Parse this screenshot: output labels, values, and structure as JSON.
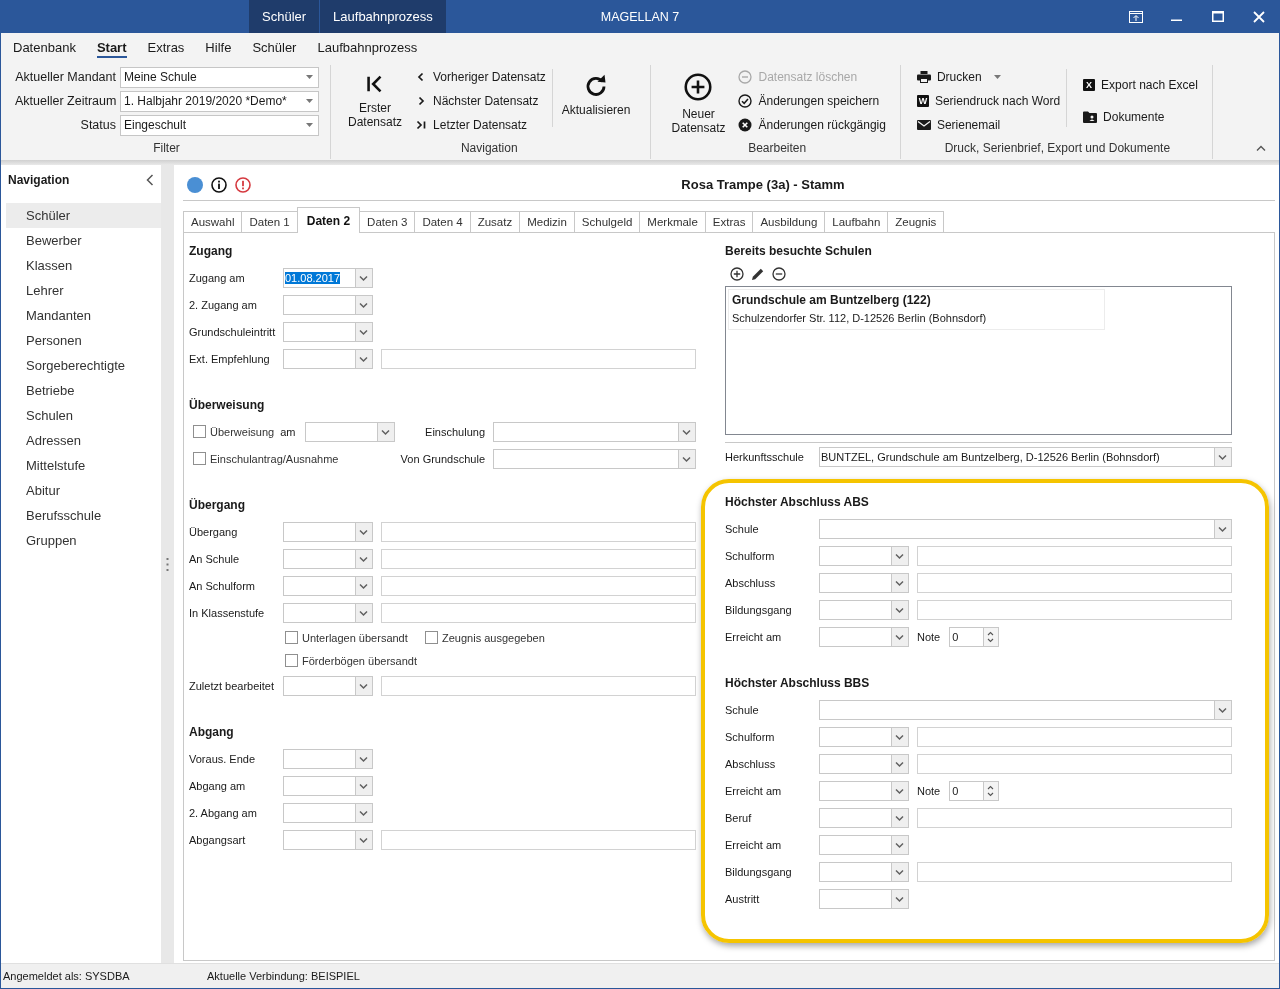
{
  "window": {
    "title": "MAGELLAN 7",
    "context_tabs": [
      "Schüler",
      "Laufbahnprozess"
    ]
  },
  "menu": [
    {
      "label": "Datenbank",
      "selected": false
    },
    {
      "label": "Start",
      "selected": true
    },
    {
      "label": "Extras",
      "selected": false
    },
    {
      "label": "Hilfe",
      "selected": false
    },
    {
      "label": "Schüler",
      "selected": false
    },
    {
      "label": "Laufbahnprozess",
      "selected": false
    }
  ],
  "ribbon": {
    "filter": {
      "label": "Filter",
      "fields": [
        {
          "label": "Aktueller Mandant",
          "value": "Meine Schule"
        },
        {
          "label": "Aktueller Zeitraum",
          "value": "1. Halbjahr 2019/2020 *Demo*"
        },
        {
          "label": "Status",
          "value": "Eingeschult"
        }
      ]
    },
    "groups": [
      {
        "label": "Navigation",
        "columns": [
          {
            "kind": "large",
            "items": [
              {
                "label": "Erster Datensatz"
              }
            ]
          },
          {
            "kind": "small",
            "items": [
              {
                "label": "Vorheriger Datensatz"
              },
              {
                "label": "Nächster Datensatz"
              },
              {
                "label": "Letzter Datensatz"
              }
            ]
          },
          {
            "kind": "large",
            "items": [
              {
                "label": "Aktualisieren"
              }
            ]
          }
        ]
      },
      {
        "label": "Bearbeiten",
        "columns": [
          {
            "kind": "large",
            "items": [
              {
                "label": "Neuer Datensatz"
              }
            ]
          },
          {
            "kind": "small",
            "items": [
              {
                "label": "Datensatz löschen",
                "disabled": true
              },
              {
                "label": "Änderungen speichern",
                "disabled": false
              },
              {
                "label": "Änderungen rückgängig",
                "disabled": false
              }
            ]
          }
        ]
      },
      {
        "label": "Druck, Serienbrief, Export und Dokumente",
        "columns": [
          {
            "kind": "small",
            "items": [
              {
                "label": "Drucken",
                "dropdown": true
              },
              {
                "label": "Seriendruck nach Word",
                "dropdown": false,
                "tile_letter": "W"
              },
              {
                "label": "Serienemail",
                "dropdown": false
              }
            ]
          },
          {
            "kind": "small",
            "items": [
              {
                "label": "Export nach Excel",
                "tile_letter": "X"
              },
              {
                "label": "Dokumente"
              }
            ]
          }
        ]
      }
    ]
  },
  "navigation": {
    "title": "Navigation",
    "items": [
      {
        "label": "Schüler",
        "selected": true
      },
      {
        "label": "Bewerber",
        "selected": false
      },
      {
        "label": "Klassen",
        "selected": false
      },
      {
        "label": "Lehrer",
        "selected": false
      },
      {
        "label": "Mandanten",
        "selected": false
      },
      {
        "label": "Personen",
        "selected": false
      },
      {
        "label": "Sorgeberechtigte",
        "selected": false
      },
      {
        "label": "Betriebe",
        "selected": false
      },
      {
        "label": "Schulen",
        "selected": false
      },
      {
        "label": "Adressen",
        "selected": false
      },
      {
        "label": "Mittelstufe",
        "selected": false
      },
      {
        "label": "Abitur",
        "selected": false
      },
      {
        "label": "Berufsschule",
        "selected": false
      },
      {
        "label": "Gruppen",
        "selected": false
      }
    ]
  },
  "record": {
    "title": "Rosa Trampe (3a) - Stamm",
    "tabs": [
      {
        "label": "Auswahl",
        "selected": false
      },
      {
        "label": "Daten 1",
        "selected": false
      },
      {
        "label": "Daten 2",
        "selected": true
      },
      {
        "label": "Daten 3",
        "selected": false
      },
      {
        "label": "Daten 4",
        "selected": false
      },
      {
        "label": "Zusatz",
        "selected": false
      },
      {
        "label": "Medizin",
        "selected": false
      },
      {
        "label": "Schulgeld",
        "selected": false
      },
      {
        "label": "Merkmale",
        "selected": false
      },
      {
        "label": "Extras",
        "selected": false
      },
      {
        "label": "Ausbildung",
        "selected": false
      },
      {
        "label": "Laufbahn",
        "selected": false
      },
      {
        "label": "Zeugnis",
        "selected": false
      }
    ],
    "left_sections": [
      {
        "heading": "Zugang",
        "rows": [
          {
            "kind": "combo",
            "label": "Zugang am",
            "value": "01.08.2017",
            "highlighted": true
          },
          {
            "kind": "combo",
            "label": "2. Zugang am"
          },
          {
            "kind": "combo",
            "label": "Grundschuleintritt"
          },
          {
            "kind": "combo_text",
            "label": "Ext. Empfehlung"
          }
        ]
      },
      {
        "heading": "Überweisung",
        "rows": [
          {
            "kind": "check_combo",
            "check": {
              "label": "Überweisung",
              "checked": false
            },
            "label": "am",
            "side_label": "Einschulung"
          },
          {
            "kind": "check_combo",
            "check": {
              "label": "Einschulantrag/Ausnahme",
              "checked": false
            },
            "side_label": "Von Grundschule"
          }
        ]
      },
      {
        "heading": "Übergang",
        "rows": [
          {
            "kind": "combo_text",
            "label": "Übergang"
          },
          {
            "kind": "combo_text",
            "label": "An Schule"
          },
          {
            "kind": "combo_text",
            "label": "An Schulform"
          },
          {
            "kind": "combo_text",
            "label": "In Klassenstufe"
          },
          {
            "kind": "checks",
            "checks": [
              {
                "label": "Unterlagen übersandt",
                "checked": false
              },
              {
                "label": "Zeugnis ausgegeben",
                "checked": false
              }
            ]
          },
          {
            "kind": "checks",
            "checks": [
              {
                "label": "Förderbögen übersandt",
                "checked": false
              }
            ]
          },
          {
            "kind": "combo_text",
            "label": "Zuletzt bearbeitet"
          }
        ]
      },
      {
        "heading": "Abgang",
        "rows": [
          {
            "kind": "combo",
            "label": "Voraus. Ende"
          },
          {
            "kind": "combo",
            "label": "Abgang am"
          },
          {
            "kind": "combo",
            "label": "2. Abgang am"
          },
          {
            "kind": "combo_text",
            "label": "Abgangsart"
          }
        ]
      }
    ],
    "schools": {
      "heading": "Bereits besuchte Schulen",
      "items": [
        {
          "name": "Grundschule am Buntzelberg (122)",
          "address": "Schulzendorfer Str. 112, D-12526 Berlin (Bohnsdorf)"
        }
      ],
      "origin": {
        "label": "Herkunftsschule",
        "value": "BUNTZEL, Grundschule am Buntzelberg, D-12526 Berlin (Bohnsdorf)"
      }
    },
    "highlighted_sections": [
      {
        "heading": "Höchster Abschluss ABS",
        "rows": [
          {
            "kind": "wide_combo",
            "label": "Schule"
          },
          {
            "kind": "combo_text",
            "label": "Schulform"
          },
          {
            "kind": "combo_text",
            "label": "Abschluss"
          },
          {
            "kind": "combo_text",
            "label": "Bildungsgang"
          },
          {
            "kind": "combo_note",
            "label": "Erreicht am",
            "note_label": "Note",
            "note_value": "0"
          }
        ]
      },
      {
        "heading": "Höchster Abschluss BBS",
        "rows": [
          {
            "kind": "wide_combo",
            "label": "Schule"
          },
          {
            "kind": "combo_text",
            "label": "Schulform"
          },
          {
            "kind": "combo_text",
            "label": "Abschluss"
          },
          {
            "kind": "combo_note",
            "label": "Erreicht am",
            "note_label": "Note",
            "note_value": "0"
          },
          {
            "kind": "combo_text",
            "label": "Beruf"
          },
          {
            "kind": "combo",
            "label": "Erreicht am"
          },
          {
            "kind": "combo_text",
            "label": "Bildungsgang"
          },
          {
            "kind": "combo",
            "label": "Austritt"
          }
        ]
      }
    ]
  },
  "status_bar": {
    "user": "Angemeldet als: SYSDBA",
    "connection": "Aktuelle Verbindung: BEISPIEL"
  }
}
